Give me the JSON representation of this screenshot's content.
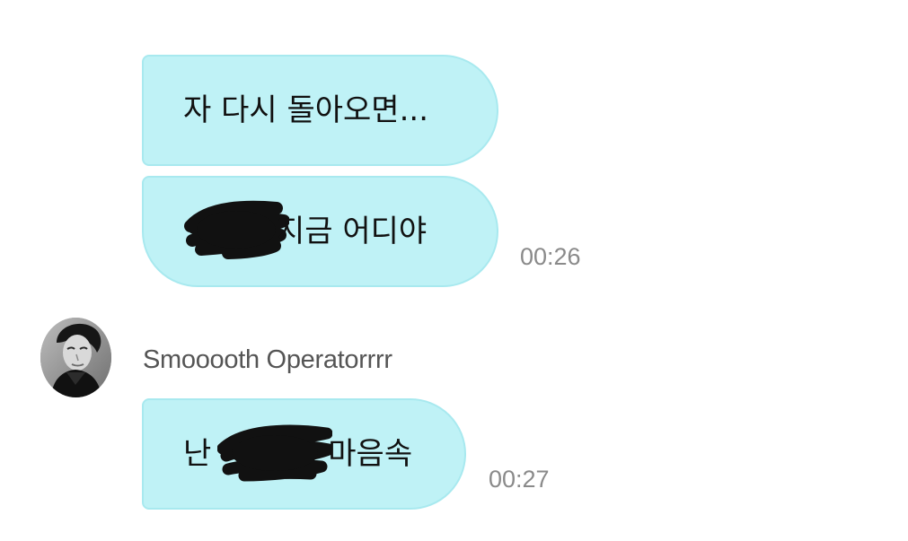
{
  "messages": [
    {
      "text": "자 다시 돌아오면..."
    },
    {
      "text_prefix": "",
      "text_suffix": "지금 어디야",
      "time": "00:26"
    },
    {
      "sender": "Smooooth Operatorrrr",
      "text_prefix": "난",
      "text_suffix": "마음속",
      "time": "00:27"
    }
  ],
  "colors": {
    "bubble": "#bff2f6",
    "bubble_border": "#a8e9ef",
    "time": "#8a8a8a",
    "sender": "#555555"
  },
  "avatar_icon": "person-portrait-icon",
  "redaction": "black-scribble-redaction"
}
